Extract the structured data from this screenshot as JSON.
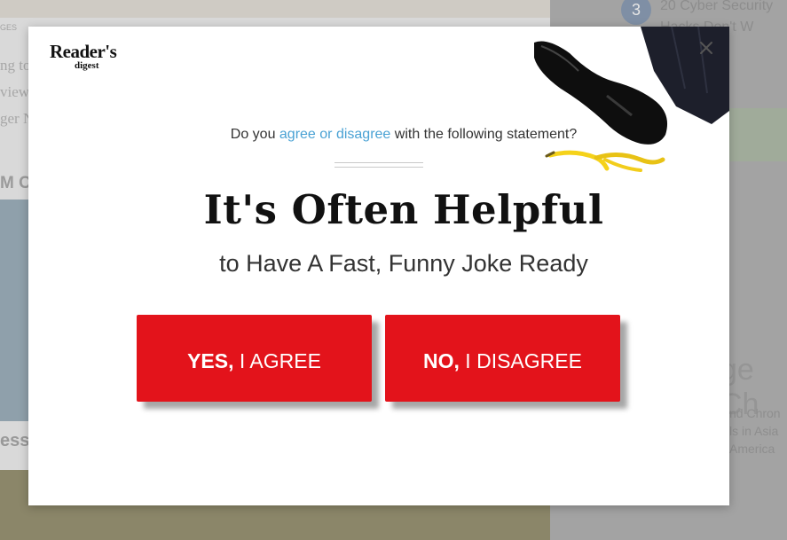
{
  "background": {
    "left_tag": "GES",
    "left_fragments": [
      "ng to",
      "view",
      "ger N"
    ],
    "left_heading": "M C",
    "left_footer": "ess",
    "right_number": "3",
    "right_lines": [
      "20 Cyber Security",
      "Hacks Don't W"
    ],
    "right_heading_fragment": "ge Ch",
    "right_small_lines": [
      "nd Chron",
      "ls in Asia",
      "America"
    ]
  },
  "modal": {
    "logo_main": "Reader's",
    "logo_sub": "digest",
    "close_icon": "close-icon",
    "question_pre": "Do you ",
    "question_link": "agree or disagree",
    "question_post": " with the following statement?",
    "headline": "It's Often Helpful",
    "subheadline": "to Have A Fast, Funny Joke Ready",
    "yes_bold": "YES,",
    "yes_rest": " I AGREE",
    "no_bold": "NO,",
    "no_rest": " I DISAGREE"
  },
  "colors": {
    "button_red": "#e3131b",
    "link_blue": "#4aa2d4",
    "banana_yellow": "#f5d21a"
  }
}
